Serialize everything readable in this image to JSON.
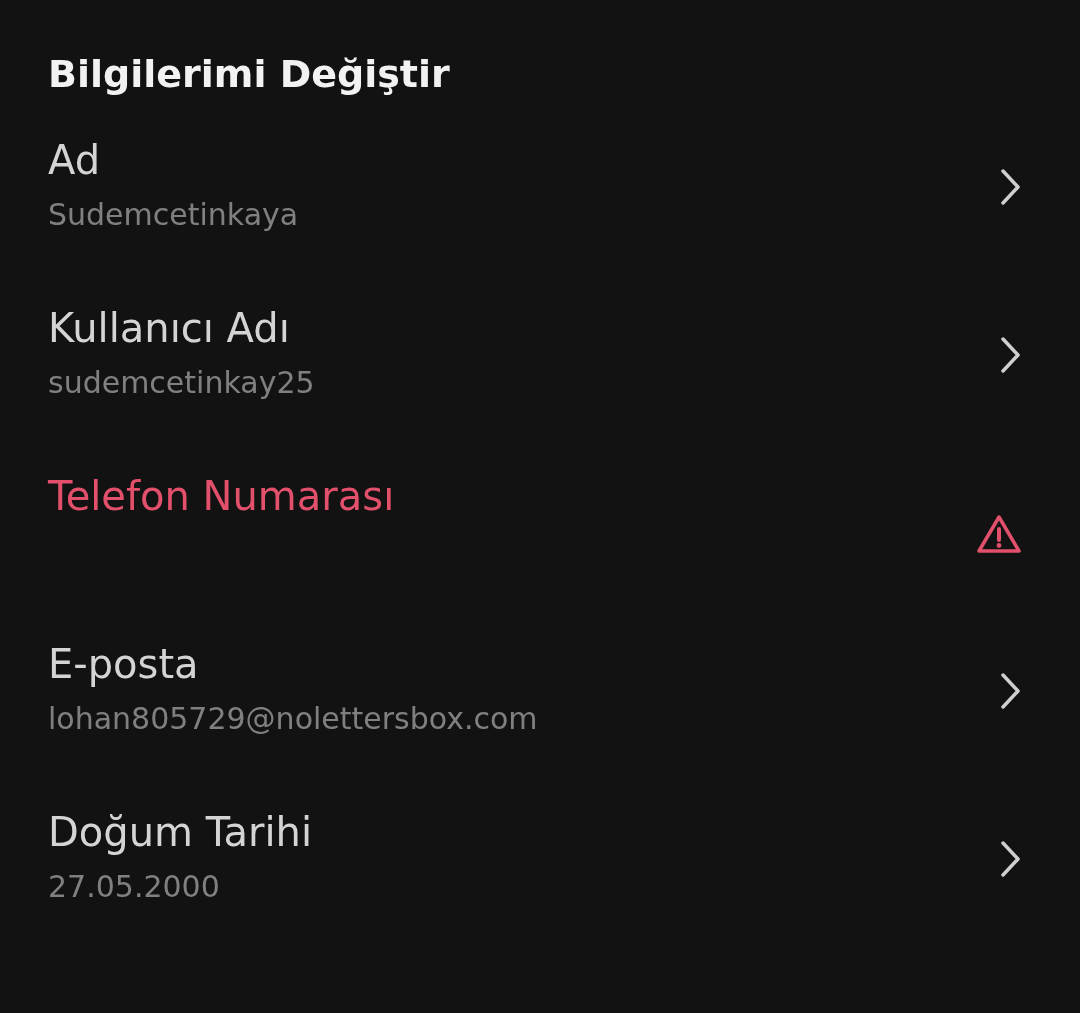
{
  "title": "Bilgilerimi Değiştir",
  "items": [
    {
      "kind": "normal",
      "label": "Ad",
      "value": "Sudemcetinkaya"
    },
    {
      "kind": "normal",
      "label": "Kullanıcı Adı",
      "value": "sudemcetinkay25"
    },
    {
      "kind": "warning",
      "label": "Telefon Numarası"
    },
    {
      "kind": "normal",
      "label": "E-posta",
      "value": "lohan805729@nolettersbox.com"
    },
    {
      "kind": "normal",
      "label": "Doğum Tarihi",
      "value": "27.05.2000"
    }
  ]
}
